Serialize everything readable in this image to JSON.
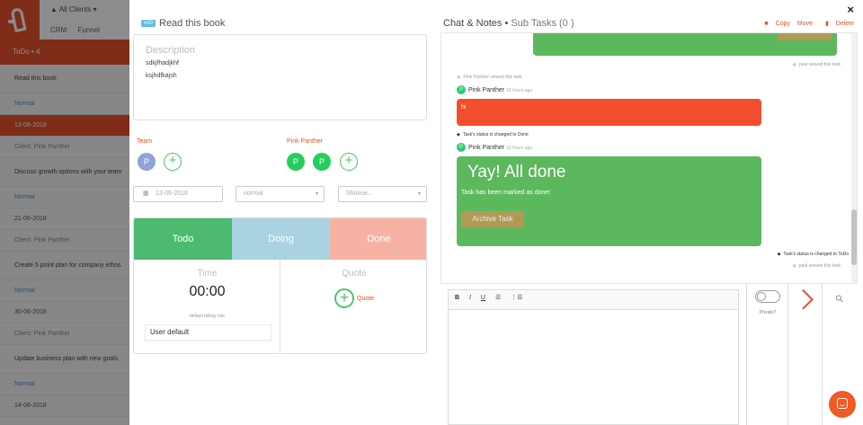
{
  "app": {
    "clients_label": "All Clients",
    "modules": [
      "CRM",
      "Funnel"
    ],
    "todo_header": "ToDo",
    "todo_header_suffix": "• 4",
    "tasks": [
      {
        "title": "Read this book",
        "priority": "Normal",
        "date": "13-06-2018",
        "client_prefix": "Client:",
        "client": "Pink Panther"
      },
      {
        "title": "Discuss growth options with your team",
        "priority": "Normal",
        "date": "21-06-2018",
        "client_prefix": "Client:",
        "client": "Pink Panther"
      },
      {
        "title": "Create 5 point plan for company ethos",
        "priority": "Normal",
        "date": "30-06-2018",
        "client_prefix": "Client:",
        "client": "Pink Panther"
      },
      {
        "title": "Update business plan with new goals",
        "priority": "Normal",
        "date": "14-06-2018"
      }
    ]
  },
  "modal": {
    "close": "×",
    "task_id": "#20",
    "title": "Read this book",
    "description": {
      "label": "Description",
      "lines": [
        "sdkjfhadjkhf",
        "ksjhdfkajsh"
      ]
    },
    "team_label": "Team",
    "team_members": [
      "P"
    ],
    "assignee_label": "Pink Panther",
    "assignees": [
      "P",
      "P"
    ],
    "date_value": "13-06-2018",
    "priority_value": "normal",
    "choose_placeholder": "Shoose...",
    "status_tabs": [
      "Todo",
      "Doing",
      "Done"
    ],
    "time_label": "Time",
    "time_value": "00:00",
    "billing_label": "default billing rate",
    "billing_value": "User default",
    "quote_label": "Quote",
    "quote_link": "Quote"
  },
  "chat": {
    "title": "Chat & Notes",
    "separator": "•",
    "subtasks_label": "Sub Tasks (0 )",
    "actions": {
      "copy": "Copy",
      "move": "Move",
      "delete": "Delete"
    },
    "viewed_1": "paul viewed this task",
    "viewed_2": "Pink Panther viewed this task",
    "author": "Pink Panther",
    "ago": "18 hours ago",
    "msg_hi": "hi",
    "status_done": "Task's status is changed to Done",
    "done_title": "Yay! All done",
    "done_sub": "Task has been marked as done!",
    "archive_button": "Archive Task",
    "status_todo": "Task's status is changed to ToDo",
    "viewed_3": "paul viewed this task"
  },
  "composer": {
    "toolbar": [
      "B",
      "I",
      "U",
      "☰",
      "⋮☰"
    ],
    "private_label": "Private?"
  },
  "colors": {
    "brand": "#e8502c",
    "green": "#5cb85c",
    "todo_tab": "#4cbb6f",
    "doing_tab": "#a9d3e0",
    "done_tab": "#f6b3a3"
  }
}
